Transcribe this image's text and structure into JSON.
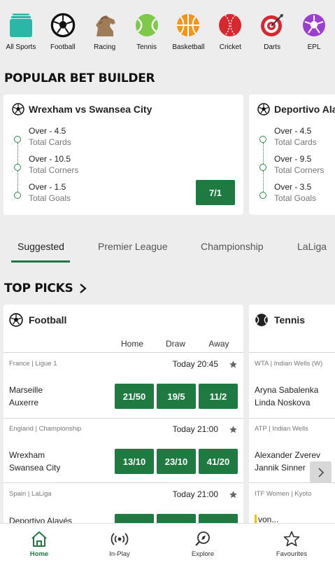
{
  "sports_nav": [
    {
      "label": "All Sports",
      "icon": "all-sports-icon"
    },
    {
      "label": "Football",
      "icon": "football-icon"
    },
    {
      "label": "Racing",
      "icon": "horse-racing-icon"
    },
    {
      "label": "Tennis",
      "icon": "tennis-ball-icon"
    },
    {
      "label": "Basketball",
      "icon": "basketball-icon"
    },
    {
      "label": "Cricket",
      "icon": "cricket-ball-icon"
    },
    {
      "label": "Darts",
      "icon": "dartboard-icon"
    },
    {
      "label": "EPL",
      "icon": "epl-icon"
    }
  ],
  "popular_bet_builder": {
    "heading": "POPULAR BET BUILDER",
    "cards": [
      {
        "title": "Wrexham vs Swansea City",
        "legs": [
          {
            "line": "Over - 4.5",
            "market": "Total Cards"
          },
          {
            "line": "Over - 10.5",
            "market": "Total Corners"
          },
          {
            "line": "Over - 1.5",
            "market": "Total Goals"
          }
        ],
        "price": "7/1"
      },
      {
        "title": "Deportivo Alav",
        "legs": [
          {
            "line": "Over - 4.5",
            "market": "Total Cards"
          },
          {
            "line": "Over - 9.5",
            "market": "Total Corners"
          },
          {
            "line": "Over - 3.5",
            "market": "Total Goals"
          }
        ]
      }
    ]
  },
  "tabs": {
    "items": [
      "Suggested",
      "Premier League",
      "Championship",
      "LaLiga"
    ],
    "active": "Suggested"
  },
  "top_picks": {
    "heading": "TOP PICKS",
    "football": {
      "title": "Football",
      "columns": [
        "Home",
        "Draw",
        "Away"
      ],
      "events": [
        {
          "competition": "France | Ligue 1",
          "time": "Today 20:45",
          "home": "Marseille",
          "away": "Auxerre",
          "odds": [
            "21/50",
            "19/5",
            "11/2"
          ]
        },
        {
          "competition": "England | Championship",
          "time": "Today 21:00",
          "home": "Wrexham",
          "away": "Swansea City",
          "odds": [
            "13/10",
            "23/10",
            "41/20"
          ]
        },
        {
          "competition": "Spain | LaLiga",
          "time": "Today 21:00",
          "home": "Deportivo Alavés"
        }
      ]
    },
    "tennis": {
      "title": "Tennis",
      "events": [
        {
          "competition": "WTA | Indian Wells (W)",
          "player1": "Aryna Sabalenka",
          "player2": "Linda Noskova"
        },
        {
          "competition": "ATP | Indian Wells",
          "player1": "Alexander Zverev",
          "player2": "Jannik Sinner"
        },
        {
          "competition": "ITF Women | Kyoto",
          "player1": "von..."
        }
      ]
    }
  },
  "bottom_nav": [
    {
      "label": "Home",
      "icon": "home-icon",
      "active": true
    },
    {
      "label": "In-Play",
      "icon": "live-broadcast-icon"
    },
    {
      "label": "Explore",
      "icon": "explore-search-icon"
    },
    {
      "label": "Favourites",
      "icon": "star-outline-icon"
    }
  ],
  "colors": {
    "brand_green": "#1e7a40",
    "background": "#ededed",
    "card": "#ffffff"
  }
}
